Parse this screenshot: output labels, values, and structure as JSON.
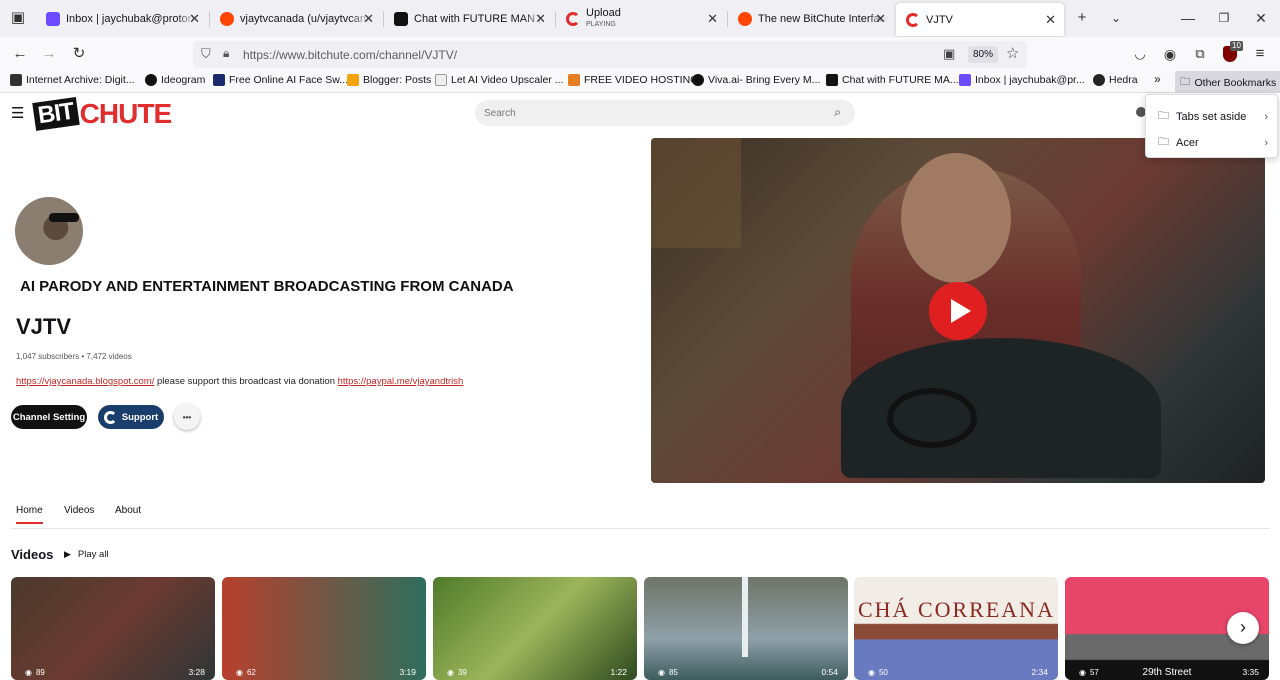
{
  "browser": {
    "tabs": [
      {
        "label": "Inbox | jaychubak@protonmail",
        "color": "#6d4aff",
        "active": false
      },
      {
        "label": "vjaytvcanada (u/vjaytvcanada",
        "color": "#ff4500",
        "active": false
      },
      {
        "label": "Chat with FUTURE MAN | ch",
        "color": "#111111",
        "active": false
      },
      {
        "label": "Upload",
        "sublabel": "PLAYING",
        "color": "#e12d2d",
        "active": false
      },
      {
        "label": "The new BitChute Interface",
        "color": "#ff4500",
        "active": false
      },
      {
        "label": "VJTV",
        "color": "#e12d2d",
        "active": true
      }
    ],
    "url": "https://www.bitchute.com/channel/VJTV/",
    "zoom": "80%",
    "badge_count": "10",
    "bookmarks": [
      {
        "label": "Internet Archive: Digit...",
        "color": "#333"
      },
      {
        "label": "Ideogram",
        "color": "#111"
      },
      {
        "label": "Free Online AI Face Sw...",
        "color": "#1a2a6b"
      },
      {
        "label": "Blogger: Posts",
        "color": "#f4a30a"
      },
      {
        "label": "Let AI Video Upscaler ...",
        "color": "#555"
      },
      {
        "label": "FREE VIDEO HOSTING",
        "color": "#e67e22"
      },
      {
        "label": "Viva.ai- Bring Every M...",
        "color": "#111"
      },
      {
        "label": "Chat with FUTURE MA...",
        "color": "#111"
      },
      {
        "label": "Inbox | jaychubak@pr...",
        "color": "#6d4aff"
      },
      {
        "label": "Hedra",
        "color": "#222"
      }
    ],
    "other_bookmarks": "Other Bookmarks",
    "bookmark_menu": [
      "Tabs set aside",
      "Acer"
    ]
  },
  "site": {
    "logo_bit": "BIT",
    "logo_chute": "CHUTE",
    "search_placeholder": "Search"
  },
  "channel": {
    "tagline": "AI PARODY AND ENTERTAINMENT BROADCASTING FROM CANADA",
    "name": "VJTV",
    "stats": "1,047 subscribers • 7,472 videos",
    "link1": "https://vjaycanada.blogspot.com/",
    "desc_mid": " please support this broadcast via donation ",
    "link2": "https://paypal.me/vjayandtrish",
    "btn_setting": "Channel Setting",
    "btn_support": "Support",
    "btn_more": "•••",
    "tabs": [
      "Home",
      "Videos",
      "About"
    ],
    "section_title": "Videos",
    "play_all": "Play all"
  },
  "videos": [
    {
      "views": "89",
      "duration": "3:28",
      "bg": "linear-gradient(135deg,#4a3a2c,#6b3a32 50%,#2f3637)"
    },
    {
      "views": "62",
      "duration": "3:19",
      "bg": "linear-gradient(90deg,#b8402e,#2e6e5c)"
    },
    {
      "views": "39",
      "duration": "1:22",
      "bg": "linear-gradient(135deg,#4f7a2a,#9cb55a 50%,#2f4a1f)"
    },
    {
      "views": "85",
      "duration": "0:54",
      "bg": "linear-gradient(180deg,#6f7468,#8fa0a8 60%,#3d5c5e)"
    },
    {
      "views": "50",
      "duration": "2:34",
      "bg": "linear-gradient(180deg,#f2ece6 0 45%,#8a4a38 46% 60%,#6a7ac0 61%)",
      "overlay": "CHÁ CORREANA"
    },
    {
      "views": "57",
      "duration": "3:35",
      "bg": "linear-gradient(180deg,#e8456a 0 55%,#6a6a6a 56% 80%,#111 81%)",
      "overlay": "29th Street"
    }
  ]
}
